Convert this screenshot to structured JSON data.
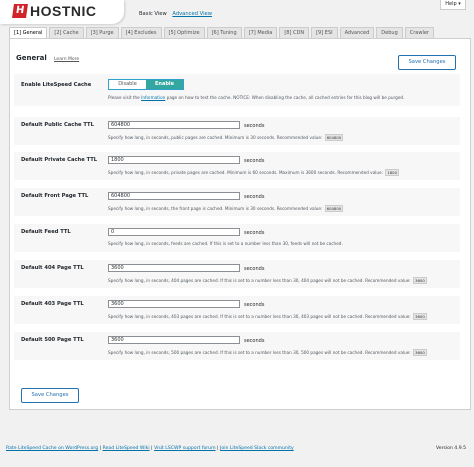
{
  "header": {
    "logo_mark": "H",
    "logo_text": "HOSTNIC",
    "basic_view": "Basic View",
    "advanced_view": "Advanced View",
    "help": "Help ▾"
  },
  "tabs": [
    {
      "label": "[1] General",
      "active": true
    },
    {
      "label": "[2] Cache"
    },
    {
      "label": "[3] Purge"
    },
    {
      "label": "[4] Excludes"
    },
    {
      "label": "[5] Optimize"
    },
    {
      "label": "[6] Tuning"
    },
    {
      "label": "[7] Media"
    },
    {
      "label": "[8] CDN"
    },
    {
      "label": "[9] ESI"
    },
    {
      "label": "Advanced"
    },
    {
      "label": "Debug"
    },
    {
      "label": "Crawler"
    }
  ],
  "section": {
    "title": "General",
    "learn_more": "Learn More",
    "save_label": "Save Changes"
  },
  "enable_cache": {
    "label": "Enable LiteSpeed Cache",
    "disable": "Disable",
    "enable": "Enable",
    "desc_pre": "Please visit the ",
    "desc_link": "Information",
    "desc_post": " page on how to test the cache. NOTICE: When disabling the cache, all cached entries for this blog will be purged."
  },
  "settings": [
    {
      "label": "Default Public Cache TTL",
      "value": "604800",
      "unit": "seconds",
      "desc": "Specify how long, in seconds, public pages are cached. Minimum is 30 seconds. Recommended value:",
      "rec": "604800"
    },
    {
      "label": "Default Private Cache TTL",
      "value": "1800",
      "unit": "seconds",
      "desc": "Specify how long, in seconds, private pages are cached. Minimum is 60 seconds. Maximum is 3600 seconds. Recommended value:",
      "rec": "1800"
    },
    {
      "label": "Default Front Page TTL",
      "value": "604800",
      "unit": "seconds",
      "desc": "Specify how long, in seconds, the front page is cached. Minimum is 30 seconds. Recommended value:",
      "rec": "604800"
    },
    {
      "label": "Default Feed TTL",
      "value": "0",
      "unit": "seconds",
      "desc": "Specify how long, in seconds, feeds are cached. If this is set to a number less than 30, feeds will not be cached.",
      "rec": ""
    },
    {
      "label": "Default 404 Page TTL",
      "value": "3600",
      "unit": "seconds",
      "desc": "Specify how long, in seconds, 404 pages are cached. If this is set to a number less than 30, 404 pages will not be cached. Recommended value:",
      "rec": "3600"
    },
    {
      "label": "Default 403 Page TTL",
      "value": "3600",
      "unit": "seconds",
      "desc": "Specify how long, in seconds, 403 pages are cached. If this is set to a number less than 30, 403 pages will not be cached. Recommended value:",
      "rec": "3600"
    },
    {
      "label": "Default 500 Page TTL",
      "value": "3600",
      "unit": "seconds",
      "desc": "Specify how long, in seconds, 500 pages are cached. If this is set to a number less than 30, 500 pages will not be cached. Recommended value:",
      "rec": "3600"
    }
  ],
  "footer": {
    "links": [
      "Rate LiteSpeed Cache on WordPress.org",
      "Read LiteSpeed Wiki",
      "Visit LSCWP support forum",
      "Join LiteSpeed Slack community"
    ],
    "separator": " | ",
    "version": "Version 4.9.5"
  }
}
